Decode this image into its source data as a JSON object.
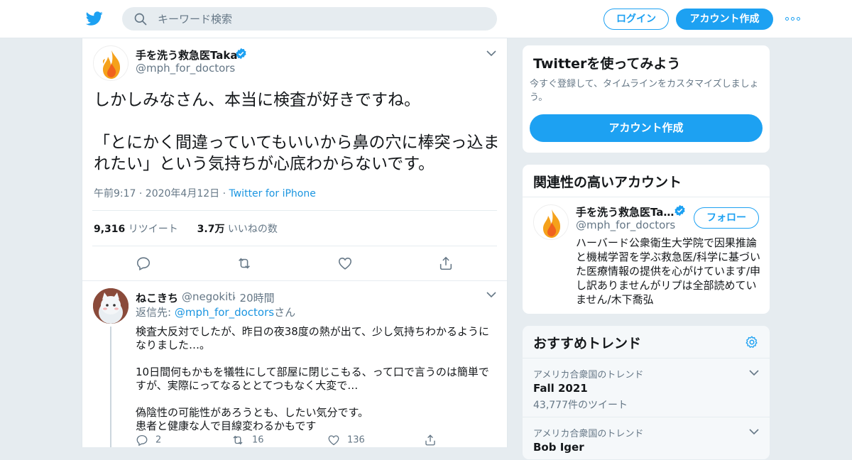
{
  "header": {
    "search_placeholder": "キーワード検索",
    "login_label": "ログイン",
    "signup_label": "アカウント作成",
    "brand_color": "#1da1f2"
  },
  "tweet": {
    "author_name": "手を洗う救急医Taka",
    "author_handle": "@mph_for_doctors",
    "paragraphs": [
      "しかしみなさん、本当に検査が好きですね。",
      "「とにかく間違っていてもいいから鼻の穴に棒突っ込まれたい」という気持ちが心底わからないです。"
    ],
    "time": "午前9:17 · 2020年4月12日",
    "separator": " · ",
    "source": "Twitter for iPhone",
    "retweet_count": "9,316",
    "retweet_label": "リツイート",
    "like_count": "3.7万",
    "like_label": "いいねの数"
  },
  "reply": {
    "author_name": "ねこきち",
    "author_handle": "@negokiti",
    "time": "· 20時間",
    "reply_to_prefix": "返信先: ",
    "reply_to_handle": "@mph_for_doctors",
    "reply_to_suffix": "さん",
    "paragraphs": [
      "検査大反対でしたが、昨日の夜38度の熱が出て、少し気持ちわかるようになりました…。",
      "10日間何もかもを犠牲にして部屋に閉じこもる、って口で言うのは簡単ですが、実際にってなるととてつもなく大変で…",
      "偽陰性の可能性があろうとも、したい気分です。\n患者と健康な人で目線変わるかもです"
    ],
    "reply_count": "2",
    "retweet_count": "16",
    "like_count": "136"
  },
  "sidebar": {
    "try_title": "Twitterを使ってみよう",
    "try_desc": "今すぐ登録して、タイムラインをカスタマイズしましょう。",
    "try_button": "アカウント作成",
    "related_title": "関連性の高いアカウント",
    "related_name": "手を洗う救急医Ta…",
    "related_handle": "@mph_for_doctors",
    "follow_label": "フォロー",
    "related_bio": "ハーバード公衆衛生大学院で因果推論と機械学習を学ぶ救急医/科学に基づいた医療情報の提供を心がけています/申し訳ありませんがリプは全部読めていません/木下喬弘",
    "trends_title": "おすすめトレンド",
    "trends": [
      {
        "location": "アメリカ合衆国のトレンド",
        "name": "Fall 2021",
        "count": "43,777件のツイート"
      },
      {
        "location": "アメリカ合衆国のトレンド",
        "name": "Bob Iger",
        "count": ""
      }
    ]
  }
}
